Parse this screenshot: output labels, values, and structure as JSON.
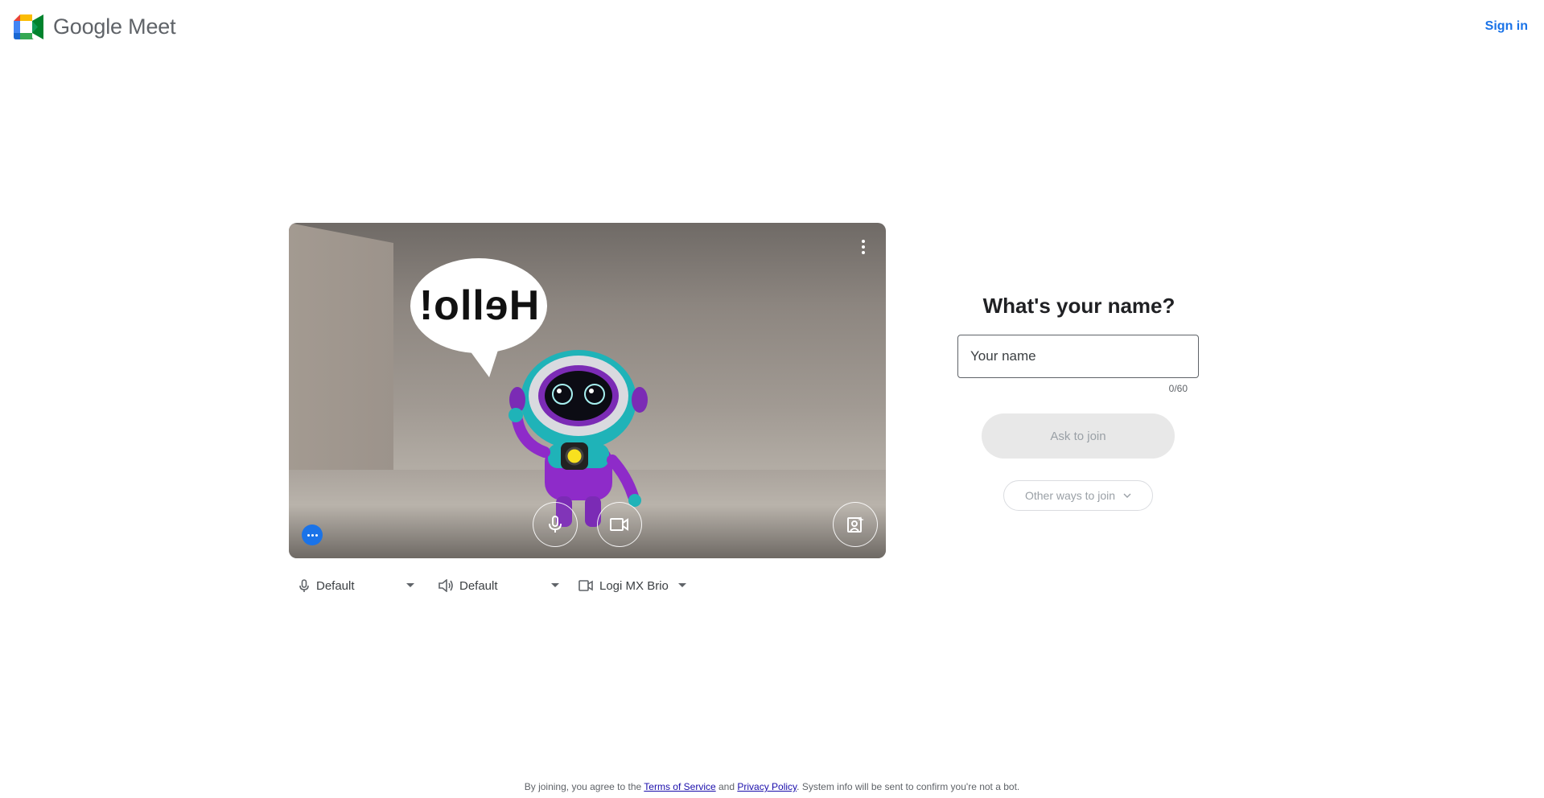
{
  "header": {
    "app_name": "Google Meet",
    "signin_label": "Sign in"
  },
  "preview": {
    "speech_bubble_text": "Hello!",
    "controls": {
      "more_options_icon": "more-vert-icon",
      "mic_icon": "microphone-icon",
      "camera_icon": "video-camera-icon",
      "effects_icon": "portrait-sparkle-icon",
      "visual_effects_icon": "more-horiz-icon"
    }
  },
  "devices": {
    "microphone": "Default",
    "speaker": "Default",
    "camera": "Logi MX Brio"
  },
  "join": {
    "title": "What's your name?",
    "name_placeholder": "Your name",
    "name_value": "",
    "char_counter": "0/60",
    "ask_to_join_label": "Ask to join",
    "other_ways_label": "Other ways to join"
  },
  "footer": {
    "prefix": "By joining, you agree to the ",
    "terms_link": "Terms of Service",
    "middle": " and ",
    "privacy_link": "Privacy Policy",
    "suffix": ". System info will be sent to confirm you're not a bot."
  },
  "colors": {
    "accent": "#1a73e8",
    "button_disabled_bg": "#e8e8e8",
    "button_disabled_text": "#9aa0a6"
  }
}
